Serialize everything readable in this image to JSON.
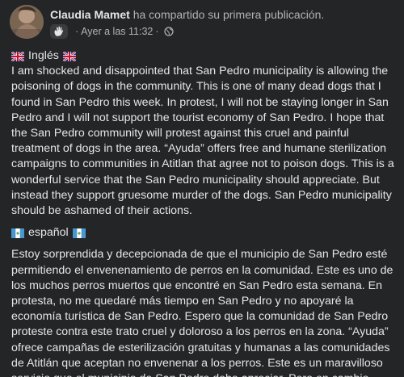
{
  "post": {
    "author": "Claudia Mamet",
    "action": "ha compartido su primera publicación.",
    "timestamp": "Ayer a las 11:32",
    "separator": "·",
    "badge_icon": "waving-hand-icon",
    "audience_icon": "globe-icon"
  },
  "sections": {
    "english": {
      "label": "Inglés",
      "flag_icon": "uk-flag-icon",
      "text": "I am shocked and disappointed that San Pedro municipality is allowing the poisoning of dogs in the community. This is one of many dead dogs that I found in San Pedro this week. In protest, I will not be staying longer in San Pedro and I will not support the tourist  economy of San Pedro. I hope that the San Pedro community will protest against this cruel and painful treatment of dogs in the area. “Ayuda” offers free and humane sterilization campaigns to communities in Atitlan that agree not to poison dogs. This is a wonderful service that the San Pedro municipality should appreciate. But instead they support gruesome murder of the dogs. San Pedro municipality should be ashamed of their actions."
    },
    "spanish": {
      "label": "español",
      "flag_icon": "guatemala-flag-icon",
      "text": "Estoy sorprendida y decepcionada de que el municipio de San Pedro esté permitiendo el envenenamiento de perros en la comunidad. Este es uno de los muchos perros muertos que encontré en San Pedro esta semana. En protesta, no me quedaré más tiempo en San Pedro y no apoyaré la economía turística de San Pedro. Espero que la comunidad de San Pedro proteste contra este trato cruel y doloroso a los perros en la zona. “Ayuda” ofrece campañas de esterilización gratuitas y humanas a las comunidades de Atitlán que aceptan no envenenar a los perros. Este es un maravilloso servicio que el municipio de San Pedro debe apreciar. Pero en cambio"
    }
  },
  "colors": {
    "background": "#242526",
    "text": "#e4e6eb",
    "secondary_text": "#b0b3b8"
  }
}
